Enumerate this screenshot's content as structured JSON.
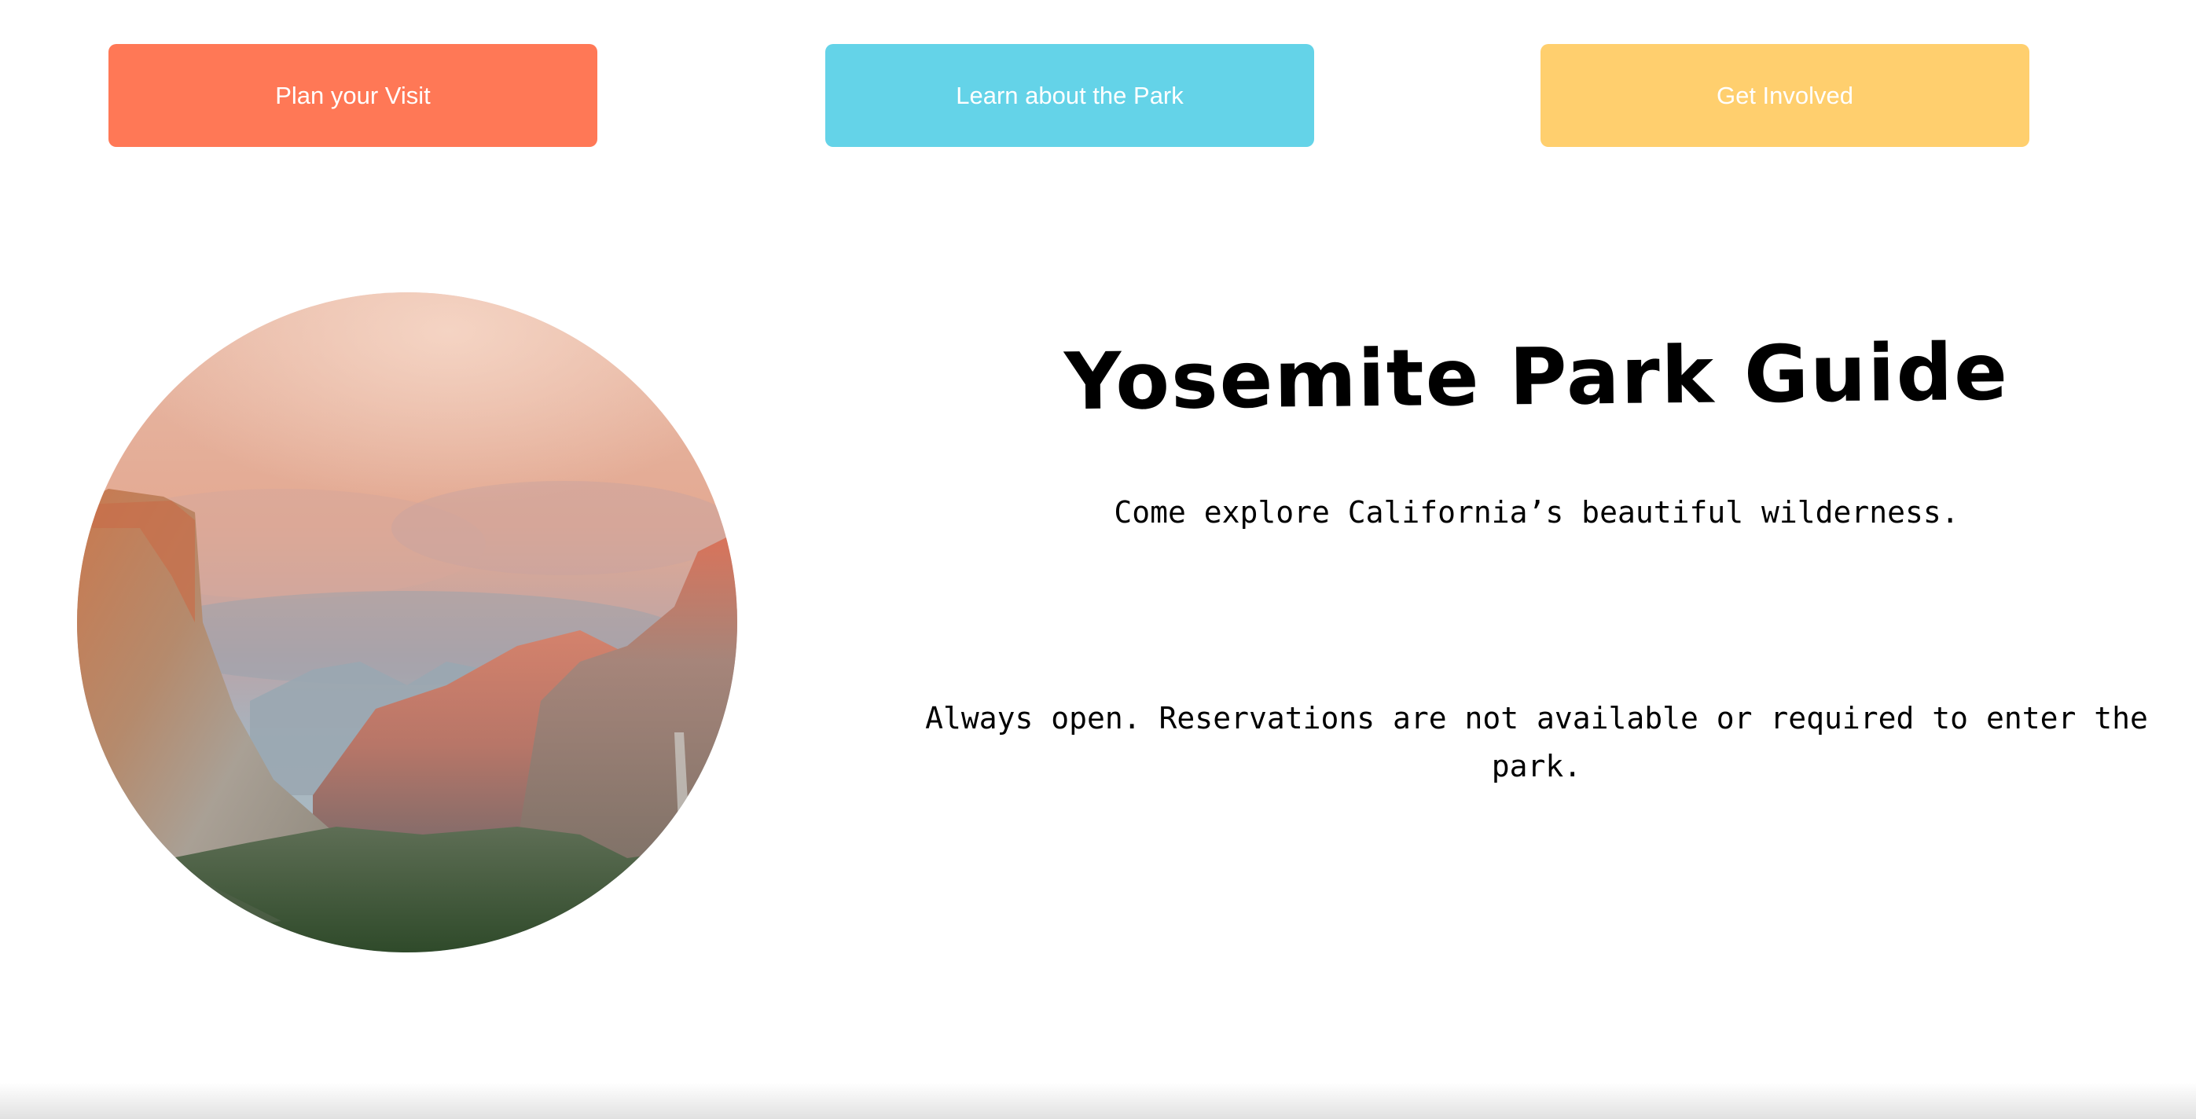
{
  "nav": {
    "buttons": [
      {
        "label": "Plan your Visit",
        "color": "#ff7856"
      },
      {
        "label": "Learn about the Park",
        "color": "#64d3e8"
      },
      {
        "label": "Get Involved",
        "color": "#ffcf6e"
      }
    ]
  },
  "hero": {
    "image_alt": "Yosemite valley landscape"
  },
  "content": {
    "title": "Yosemite Park Guide",
    "subtitle": "Come explore California’s beautiful wilderness.",
    "hours_line1": "Always open. Reservations are not available or required to enter the",
    "hours_line2": "park."
  }
}
